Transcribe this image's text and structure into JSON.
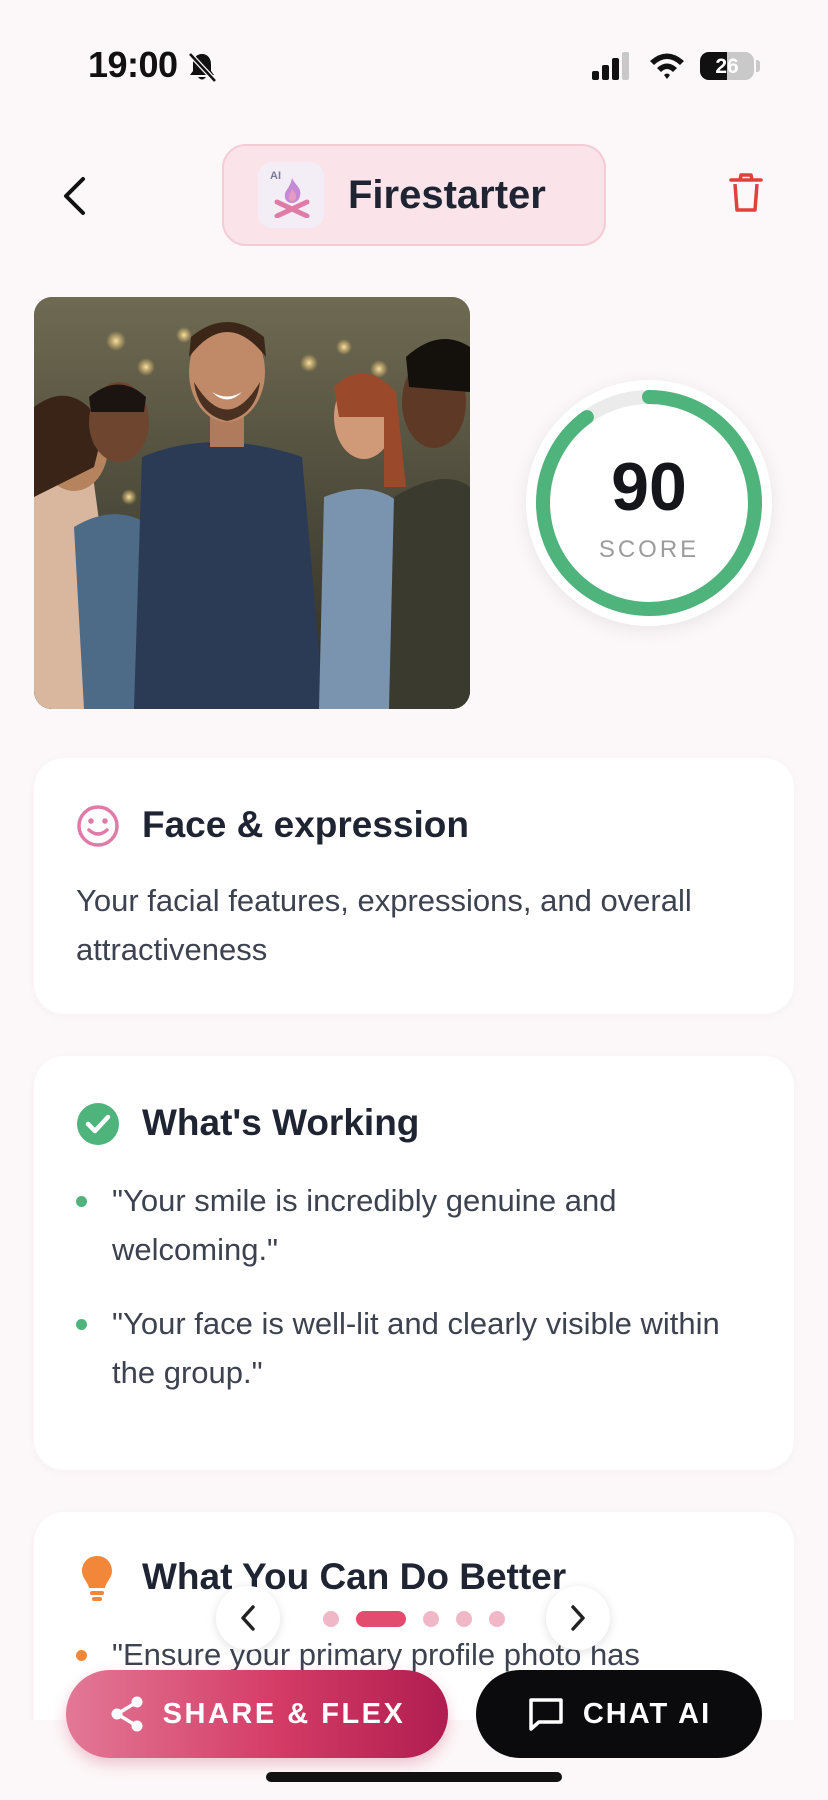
{
  "status_bar": {
    "time": "19:00",
    "battery": "26",
    "icons": [
      "bell-slash-icon",
      "signal-icon",
      "wifi-icon",
      "battery-icon"
    ]
  },
  "header": {
    "back_icon": "chevron-left-icon",
    "logo_badge": "AI",
    "title": "Firestarter",
    "delete_icon": "trash-icon"
  },
  "photo": {
    "description_icon": "group-photo"
  },
  "score": {
    "value": "90",
    "label": "SCORE",
    "fraction": 0.9,
    "color": "#4fb37c",
    "track_color": "#ebebeb"
  },
  "face_card": {
    "icon": "smiley-icon",
    "heading": "Face & expression",
    "body": "Your facial features, expressions, and overall attractiveness"
  },
  "working_card": {
    "icon": "check-circle-icon",
    "heading": "What's Working",
    "items": [
      "\"Your smile is incredibly genuine and welcoming.\"",
      "\"Your face is well-lit and clearly visible within the group.\""
    ]
  },
  "better_card": {
    "icon": "lightbulb-icon",
    "heading": "What You Can Do Better",
    "items": [
      "\"Ensure your primary profile photo has"
    ]
  },
  "pager": {
    "total": 5,
    "active_index": 1
  },
  "actions": {
    "share_label": "SHARE & FLEX",
    "chat_label": "CHAT AI"
  },
  "colors": {
    "accent_pink": "#e24c6e",
    "success_green": "#4fb37c",
    "tip_orange": "#f2873a",
    "trash_red": "#e0413c"
  }
}
